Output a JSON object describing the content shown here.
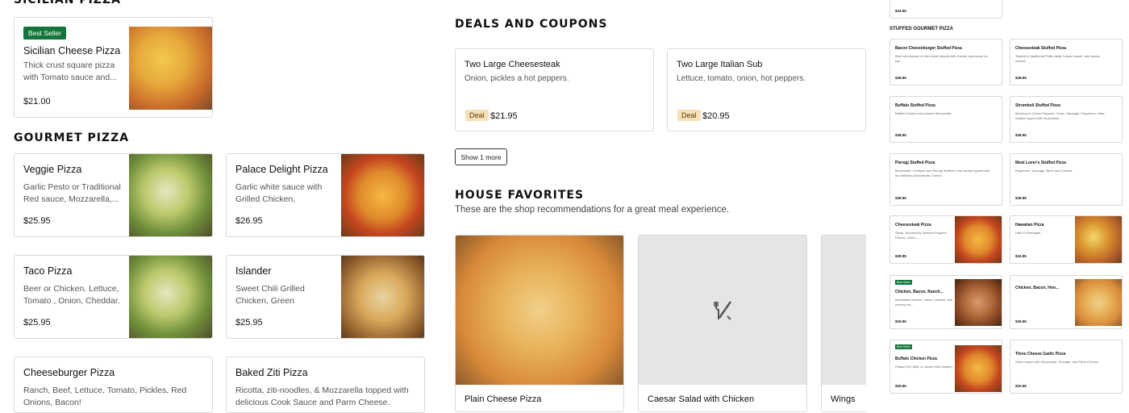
{
  "sections": {
    "sicilian": "SICILIAN PIZZA",
    "gourmet": "GOURMET PIZZA",
    "deals": "DEALS AND COUPONS",
    "house": "HOUSE FAVORITES",
    "house_sub": "These are the shop recommendations for a great meal experience.",
    "stuffed": "STUFFED GOURMET PIZZA"
  },
  "best_seller_label": "Best Seller",
  "sicilian_item": {
    "name": "Sicilian Cheese Pizza",
    "desc": "Thick crust square pizza with Tomato sauce and...",
    "price": "$21.00"
  },
  "gourmet_items": [
    {
      "name": "Veggie Pizza",
      "desc": "Garlic Pesto or Traditional Red sauce, Mozzarella,...",
      "price": "$25.95"
    },
    {
      "name": "Palace Delight Pizza",
      "desc": "Garlic white sauce with Grilled Chicken, Tomato,...",
      "price": "$26.95"
    },
    {
      "name": "Taco Pizza",
      "desc": "Beer or Chicken. Lettuce, Tomato , Onion, Cheddar.",
      "price": "$25.95"
    },
    {
      "name": "Islander",
      "desc": "Sweet Chili Grilled Chicken, Green Peppers,...",
      "price": "$25.95"
    },
    {
      "name": "Cheeseburger Pizza",
      "desc": "Ranch, Beef, Lettuce, Tomato, Pickles, Red Onions, Bacon!",
      "price": ""
    },
    {
      "name": "Baked Ziti Pizza",
      "desc": "Ricotta, ziti-noodles, & Mozzarella topped with delicious Cook Sauce and Parm Cheese.",
      "price": ""
    }
  ],
  "deals": [
    {
      "name": "Two Large Cheesesteak",
      "desc": "Onion, pickles a hot peppers.",
      "tag": "Deal",
      "price": "$21.95"
    },
    {
      "name": "Two Large Italian Sub",
      "desc": "Lettuce, tomato, onion, hot peppers.",
      "tag": "Deal",
      "price": "$20.95"
    }
  ],
  "show_more": "Show 1 more",
  "favorites": [
    {
      "name": "Plain Cheese Pizza"
    },
    {
      "name": "Caesar Salad with Chicken"
    },
    {
      "name": "Wings"
    }
  ],
  "side": {
    "top_price": "$24.95",
    "items": [
      {
        "name": "Bacon Cheeseburger Stuffed Pizza",
        "desc": "Beef and cheese on the inside topped with cheese and bacon on top!",
        "price": "$38.95",
        "badge": ""
      },
      {
        "name": "Cheesesteak Stuffed Pizza",
        "desc": "Topped in traditional Philly steak, tomato sauce, and classic cheese.",
        "price": "$38.95",
        "badge": ""
      },
      {
        "name": "Buffalo Stuffed Pizza",
        "desc": "Buffalo Chicken and classic Mozzarella",
        "price": "$38.95",
        "badge": ""
      },
      {
        "name": "Stromboli Stuffed Pizza",
        "desc": "Mushroom, Green Peppers, Onion, Sausage, Pepperoni, Ham, Salami topped with mozzarella...",
        "price": "$38.95",
        "badge": ""
      },
      {
        "name": "Pierogi Stuffed Pizza",
        "desc": "Mozzarella, Cheddar, and Pierogi stuffed in the middle topped with the delicious Mozzarella, Chedd...",
        "price": "$38.95",
        "badge": ""
      },
      {
        "name": "Meat Lover's Stuffed Pizza",
        "desc": "Pepperoni, Sausage, Beef, and Cheese.",
        "price": "$38.95",
        "badge": ""
      },
      {
        "name": "Cheesesteak Pizza",
        "desc": "Steak, Mozzarella, Banana Peppers, Pickles, Onion,...",
        "price": "$28.95",
        "badge": ""
      },
      {
        "name": "Hawaiian Pizza",
        "desc": "Ham & Pineapple.",
        "price": "$24.95",
        "badge": ""
      },
      {
        "name": "Chicken, Bacon, Ranch...",
        "desc": "Mozzarella cheese, bacon, chicken, and yummy ran...",
        "price": "$25.95",
        "badge": "Best Seller"
      },
      {
        "name": "Chicken, Bacon, Hon...",
        "desc": "",
        "price": "$29.95",
        "badge": ""
      },
      {
        "name": "Buffalo Chicken Pizza",
        "desc": "Palace Hot, Mild, or Sweet Chili chicken.",
        "price": "$29.95",
        "badge": "Best Seller"
      },
      {
        "name": "Three Cheese Garlic Pizza",
        "desc": "Garlic based with Mozzarella, Cheddar, and Parm Cheese.",
        "price": "$20.95",
        "badge": ""
      }
    ]
  }
}
